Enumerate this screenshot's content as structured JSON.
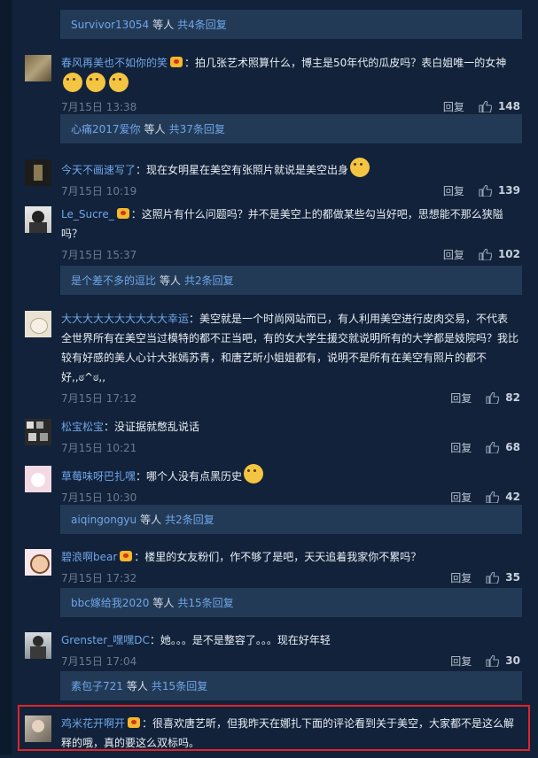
{
  "colors": {
    "bg": "#12223a",
    "user": "#6fa6e8",
    "replybar": "#233a57",
    "highlight": "#e0242a"
  },
  "reply_label": "回复",
  "replybars": [
    {
      "user": "Survivor13054",
      "mid": "等人",
      "more": "共4条回复"
    },
    {
      "user": "心痛2017爱你",
      "mid": "等人",
      "more": "共37条回复"
    },
    {
      "user": "是个差不多的逗比",
      "mid": "等人",
      "more": "共2条回复"
    },
    {
      "user": "aiqingongyu",
      "mid": "等人",
      "more": "共2条回复"
    },
    {
      "user": "bbc嫁给我2020",
      "mid": "等人",
      "more": "共15条回复"
    },
    {
      "user": "素包子721",
      "mid": "等人",
      "more": "共15条回复"
    }
  ],
  "comments": [
    {
      "user": "春风再美也不如你的笑",
      "text": "：拍几张艺术照算什么，博主是50年代的瓜皮吗？表白姐唯一的女神",
      "date": "7月15日 13:38",
      "likes": "148"
    },
    {
      "user": "今天不画速写了",
      "text": "：现在女明星在美空有张照片就说是美空出身",
      "date": "7月15日 10:19",
      "likes": "139"
    },
    {
      "user": "Le_Sucre_",
      "text1": "：这照片有什么问题吗？并不是美空上的都做某些勾当好吧，思想能不那么狭隘",
      "text2": "吗？",
      "date": "7月15日 15:37",
      "likes": "102"
    },
    {
      "user": "大大大大大大大大大大幸运",
      "text1": "：美空就是一个时尚网站而已，有人利用美空进行皮肉交易，不代表",
      "text2": "全世界所有在美空当过模特的都不正当吧，有的女大学生援交就说明所有的大学都是妓院吗？我比",
      "text3": "较有好感的美人心计大张嫣苏青，和唐艺昕小姐姐都有，说明不是所有在美空有照片的都不",
      "text4": "好,,ಠ^ಠ,,",
      "date": "7月15日 17:12",
      "likes": "82"
    },
    {
      "user": "松宝松宝",
      "text": "：没证据就憋乱说话",
      "date": "7月15日 10:21",
      "likes": "68"
    },
    {
      "user": "草莓味呀巴扎嘿",
      "text": "：哪个人没有点黑历史",
      "date": "7月15日 10:30",
      "likes": "42"
    },
    {
      "user": "碧浪啊bear",
      "text": "：楼里的女友粉们，作不够了是吧，天天追着我家你不累吗？",
      "date": "7月15日 17:32",
      "likes": "35"
    },
    {
      "user": "Grenster_嘿嘿DC",
      "text": "：她。。。是不是整容了。。。现在好年轻",
      "date": "7月15日 17:04",
      "likes": "30"
    },
    {
      "user": "鸡米花开啊开",
      "text1": "：很喜欢唐艺昕，但我昨天在娜扎下面的评论看到关于美空，大家都不是这么解",
      "text2": "释的哦，真的要这么双标吗。"
    }
  ]
}
